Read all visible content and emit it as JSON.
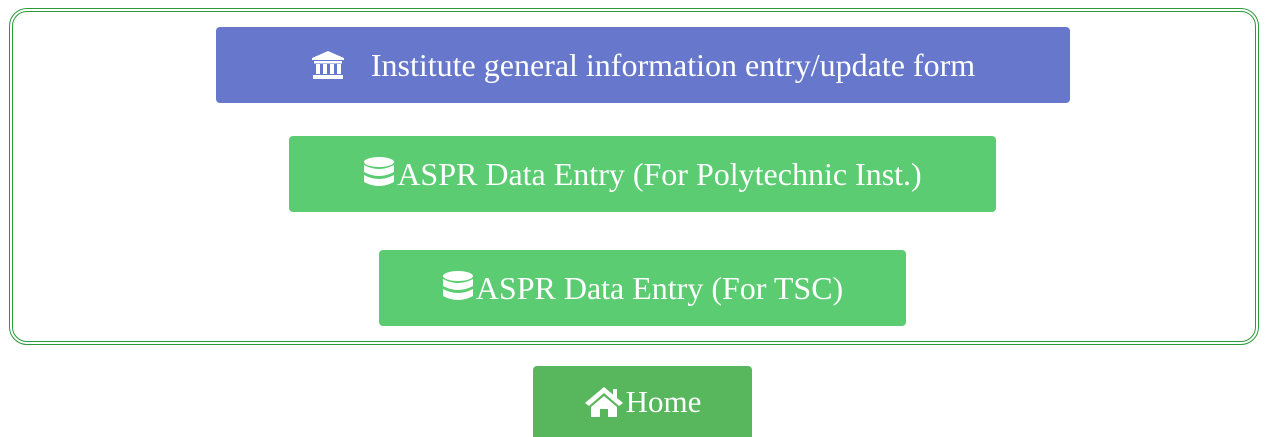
{
  "menu": {
    "institute_button_label": "Institute general information entry/update form",
    "institute_icon": "institution-icon",
    "polytechnic_button_label": "ASPR Data Entry (For Polytechnic Inst.)",
    "tsc_button_label": "ASPR Data Entry (For TSC)",
    "database_icon": "database-icon"
  },
  "footer": {
    "home_label": "Home",
    "home_icon": "home-icon"
  },
  "colors": {
    "primary_button": "#6677cc",
    "success_button": "#5ccc72",
    "home_button": "#58b75c",
    "panel_border": "#2a9a3a"
  }
}
